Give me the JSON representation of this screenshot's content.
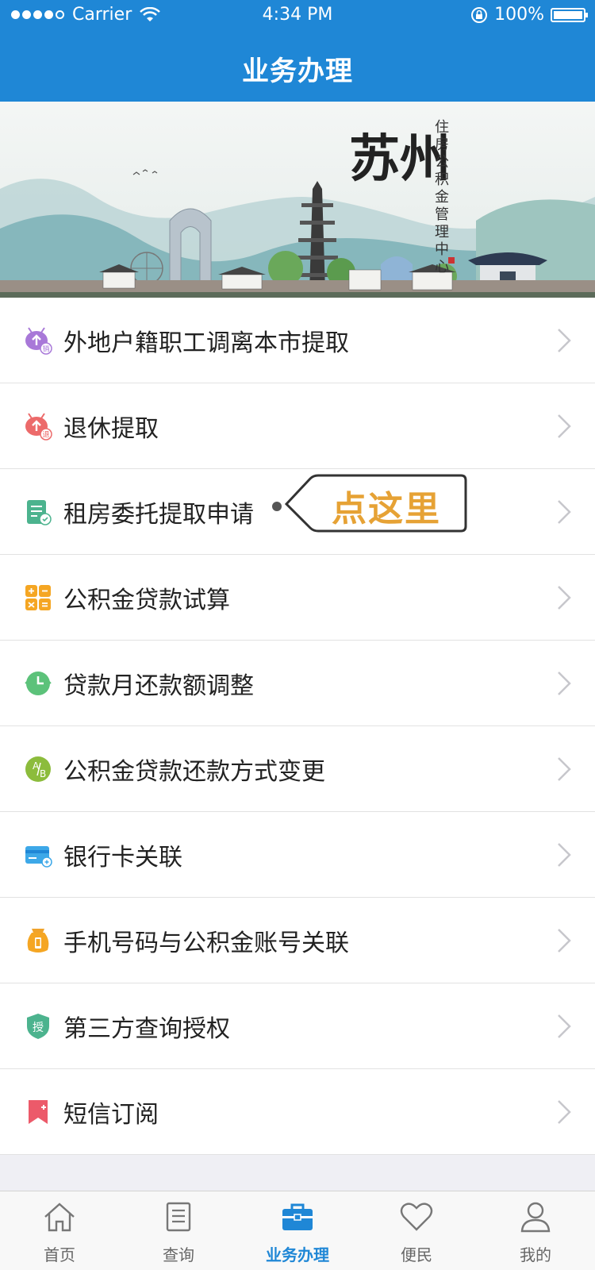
{
  "status_bar": {
    "carrier": "Carrier",
    "time": "4:34 PM",
    "battery": "100%"
  },
  "nav": {
    "title": "业务办理"
  },
  "banner": {
    "title": "苏州",
    "subtitle": "住房公积金管理中心"
  },
  "list": [
    {
      "label": "外地户籍职工调离本市提取",
      "icon": "withdraw-transfer-icon"
    },
    {
      "label": "退休提取",
      "icon": "retire-withdraw-icon"
    },
    {
      "label": "租房委托提取申请",
      "icon": "rent-document-icon"
    },
    {
      "label": "公积金贷款试算",
      "icon": "calculator-icon"
    },
    {
      "label": "贷款月还款额调整",
      "icon": "clock-icon"
    },
    {
      "label": "公积金贷款还款方式变更",
      "icon": "ab-switch-icon"
    },
    {
      "label": "银行卡关联",
      "icon": "bank-card-icon"
    },
    {
      "label": "手机号码与公积金账号关联",
      "icon": "phone-bag-icon"
    },
    {
      "label": "第三方查询授权",
      "icon": "authorize-shield-icon"
    },
    {
      "label": "短信订阅",
      "icon": "sms-bookmark-icon"
    }
  ],
  "callout": {
    "text": "点这里"
  },
  "tabs": [
    {
      "label": "首页",
      "icon": "home-icon"
    },
    {
      "label": "查询",
      "icon": "query-document-icon"
    },
    {
      "label": "业务办理",
      "icon": "briefcase-icon"
    },
    {
      "label": "便民",
      "icon": "heart-icon"
    },
    {
      "label": "我的",
      "icon": "user-icon"
    }
  ],
  "colors": {
    "primary": "#1f87d6",
    "callout_text": "#e6a235"
  }
}
